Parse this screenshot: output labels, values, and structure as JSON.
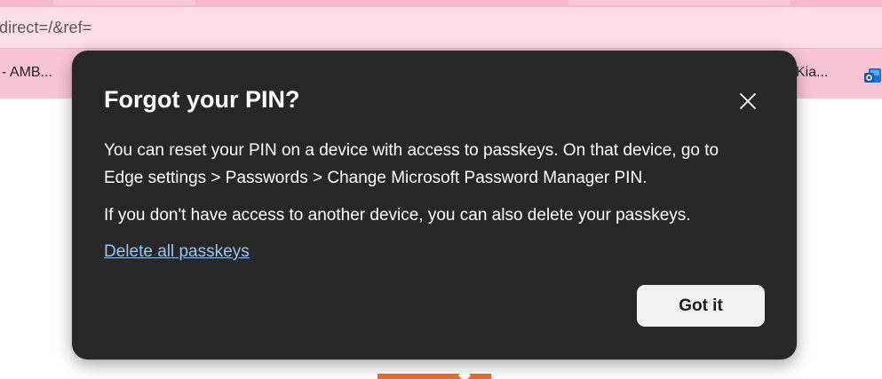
{
  "browser": {
    "address_text": "direct=/&ref=",
    "favorites": {
      "left_item": "- AMB...",
      "right_item": "Kia...",
      "outlook_icon": "outlook-icon"
    },
    "colors": {
      "toolbar_pink": "#fcdde8",
      "favorites_pink": "#f9c5d6"
    }
  },
  "dialog": {
    "title": "Forgot your PIN?",
    "paragraph1": "You can reset your PIN on a device with access to passkeys. On that device, go to Edge settings > Passwords > Change Microsoft Password Manager PIN.",
    "paragraph2": "If you don't have access to another device, you can also delete your passkeys.",
    "delete_link": "Delete all passkeys",
    "confirm_button": "Got it",
    "close_icon": "close-icon",
    "colors": {
      "background": "#272727",
      "link": "#99c5f5",
      "button_bg": "#f2f2f2"
    }
  }
}
